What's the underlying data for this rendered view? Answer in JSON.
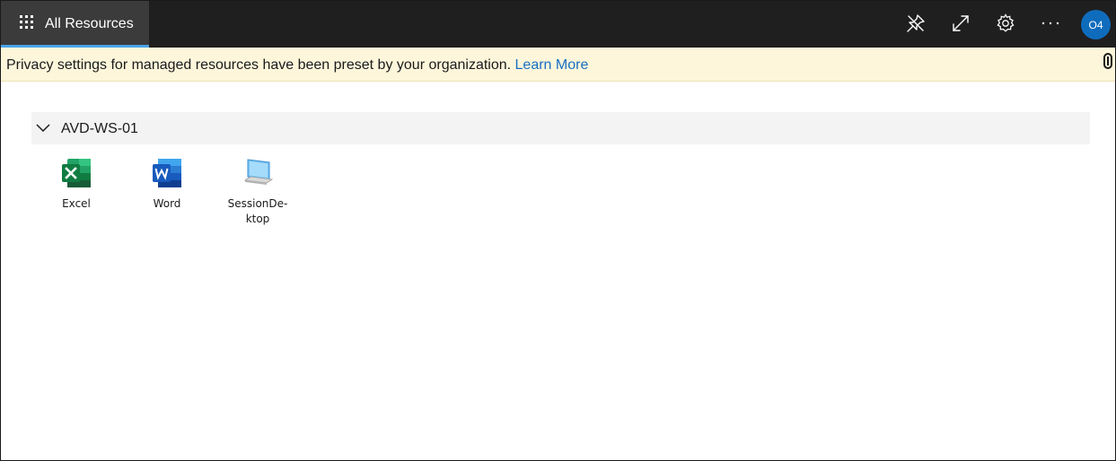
{
  "topbar": {
    "tab_label": "All Resources",
    "icons": [
      "pin-icon",
      "expand-icon",
      "settings-icon",
      "more-icon"
    ],
    "avatar_initials": "O4",
    "accent_color": "#4aa3e8"
  },
  "notice": {
    "text": "Privacy settings for managed resources have been preset by your organization. ",
    "link_text": "Learn More"
  },
  "group": {
    "title": "AVD-WS-01",
    "expanded": true
  },
  "resources": [
    {
      "label": "Excel",
      "icon": "excel-icon"
    },
    {
      "label": "Word",
      "icon": "word-icon"
    },
    {
      "label": "SessionDe-\nktop",
      "icon": "desktop-icon"
    }
  ]
}
